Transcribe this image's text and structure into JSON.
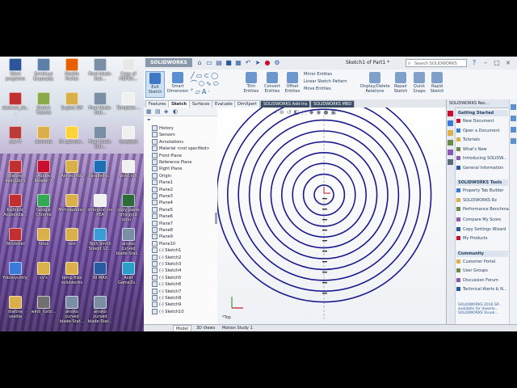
{
  "desktop": {
    "icons": [
      {
        "label": "Word programs",
        "color": "#2b579a"
      },
      {
        "label": "Εκτύπωσ Εγγραφής",
        "color": "#5b7fa8"
      },
      {
        "label": "Mozilla Firefox",
        "color": "#e66000"
      },
      {
        "label": "Final blade-Stat...",
        "color": "#7a8ea6"
      },
      {
        "label": "Copy of ΠΕΡΙΕΧ...",
        "color": "#e8e8e8"
      },
      {
        "label": "abstract_de...",
        "color": "#c03030"
      },
      {
        "label": "Skatch Tutorial",
        "color": "#8aaa4a"
      },
      {
        "label": "Συχδαί SW",
        "color": "#d9b04a"
      },
      {
        "label": "Final blade-Stat...",
        "color": "#7a8ea6"
      },
      {
        "label": "Template-...",
        "color": "#f0f0f0"
      },
      {
        "label": "σAv Π",
        "color": "#bb3a3a"
      },
      {
        "label": "stoivmia",
        "color": "#d9b04a"
      },
      {
        "label": "NI Labview...",
        "color": "#ffd23a"
      },
      {
        "label": "Final blade-Stat...",
        "color": "#7a8ea6"
      },
      {
        "label": "template",
        "color": "#f0f0f0"
      },
      {
        "label": "diafora πράγματα",
        "color": "#c03030"
      },
      {
        "label": "Adobe Reader X",
        "color": "#c8102e"
      },
      {
        "label": "Airnet PNG",
        "color": "#d9b04a"
      },
      {
        "label": "ParallelPo...",
        "color": "#1e6fb8"
      },
      {
        "label": "wind.run",
        "color": "#f0f0f0"
      },
      {
        "label": "Κωδικός Αεροσκάφ...",
        "color": "#c03030"
      },
      {
        "label": "Google Chrome",
        "color": "#34a853"
      },
      {
        "label": "Μεταφράσεις",
        "color": "#d9b04a"
      },
      {
        "label": "στοιχεία για ΡΕΑ",
        "color": "#f0f0f0"
      },
      {
        "label": "copy paste στοιχεία ραγι...",
        "color": "#2d6b3a"
      },
      {
        "label": "Windoller",
        "color": "#c03030"
      },
      {
        "label": "fotos",
        "color": "#d9b04a"
      },
      {
        "label": "test",
        "color": "#d9b04a"
      },
      {
        "label": "Tech Smith Snagit 12...",
        "color": "#3a9bd9"
      },
      {
        "label": "ansiko curved blade-Stat...",
        "color": "#7a8ea6"
      },
      {
        "label": "Υπολογιστής",
        "color": "#3a7bd9"
      },
      {
        "label": "cv's",
        "color": "#d9b04a"
      },
      {
        "label": "temp files solidworks",
        "color": "#d9b04a"
      },
      {
        "label": "NI MAX",
        "color": "#2a5aa0"
      },
      {
        "label": "Acer GameZo...",
        "color": "#2aa0c8"
      },
      {
        "label": "diafora sxedia",
        "color": "#d9b04a"
      },
      {
        "label": "wind_turbi...",
        "color": "#707070"
      },
      {
        "label": "ansiko curved blade-Stat...",
        "color": "#7a8ea6"
      },
      {
        "label": "ansiko curved blade-Stat...",
        "color": "#7a8ea6"
      }
    ]
  },
  "app": {
    "logo": "SOLIDWORKS",
    "doc_title": "Sketch1 of Part1 *",
    "search_placeholder": "Search SOLIDWORKS Help",
    "accent": "#c8102e",
    "ribbon": {
      "buttons": [
        {
          "label": "Exit Sketch"
        },
        {
          "label": "Smart Dimension"
        },
        {
          "label": "Trim Entities"
        },
        {
          "label": "Convert Entities"
        },
        {
          "label": "Offset Entities"
        },
        {
          "label": "Display/Delete Relations"
        },
        {
          "label": "Repair Sketch"
        },
        {
          "label": "Quick Snaps"
        },
        {
          "label": "Rapid Sketch"
        }
      ],
      "list": [
        "Mirror Entities",
        "Linear Sketch Pattern",
        "Move Entities"
      ]
    },
    "tabs": [
      "Features",
      "Sketch",
      "Surfaces",
      "Evaluate",
      "DimXpert",
      "SOLIDWORKS Add-Ins",
      "SOLIDWORKS MBD"
    ],
    "active_tab": "Sketch",
    "tree": {
      "items": [
        "History",
        "Sensors",
        "Annotations",
        "Material <not specified>",
        "Front Plane",
        "Reference Plane",
        "Right Plane",
        "Origin",
        "Plane1",
        "Plane2",
        "Plane3",
        "Plane4",
        "Plane5",
        "Plane6",
        "Plane7",
        "Plane8",
        "Plane9",
        "Plane10",
        "(-) Sketch1",
        "(-) Sketch2",
        "(-) Sketch3",
        "(-) Sketch4",
        "(-) Sketch5",
        "(-) Sketch6",
        "(-) Sketch7",
        "(-) Sketch8",
        "(-) Sketch9",
        "(-) Sketch10"
      ]
    },
    "bottom_tabs": [
      "Model",
      "3D Views",
      "Motion Study 1"
    ],
    "view_label": "*Top",
    "task_pane": {
      "header": "SOLIDWORKS Res...",
      "sections": [
        {
          "title": "Getting Started",
          "items": [
            "New Document",
            "Open a Document",
            "Tutorials",
            "What's New",
            "Introducing SOLIDW...",
            "General Information"
          ]
        },
        {
          "title": "SOLIDWORKS Tools",
          "items": [
            "Property Tab Builder",
            "SOLIDWORKS Rx",
            "Performance Benchmark Test",
            "Compare My Score",
            "Copy Settings Wizard",
            "My Products"
          ]
        },
        {
          "title": "Community",
          "items": [
            "Customer Portal",
            "User Groups",
            "Discussion Forum",
            "Technical Alerts & N..."
          ]
        }
      ],
      "note": "SOLIDWORKS 2016 SP... available for downlo... SOLIDWORKS Visual..."
    },
    "sketch": {
      "circle_count": 10,
      "color": "#1a1a8c"
    }
  }
}
